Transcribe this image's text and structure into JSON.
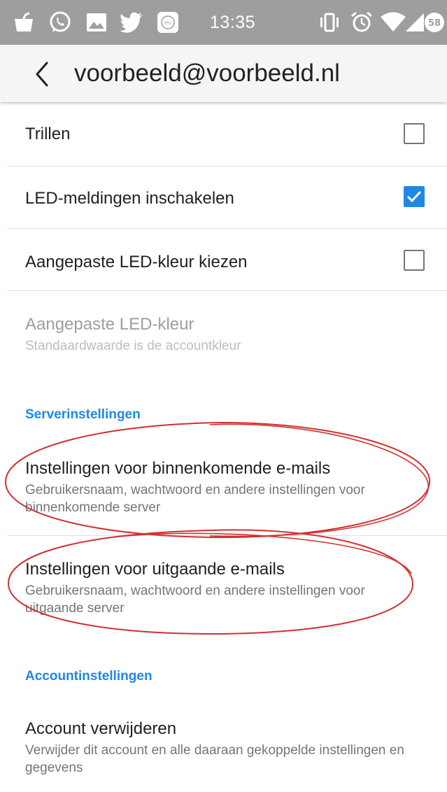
{
  "status_bar": {
    "time": "13:35",
    "battery_level": "58",
    "notification_icons": [
      "app-icon",
      "whatsapp-icon",
      "gallery-icon",
      "twitter-icon",
      "mi-icon"
    ],
    "system_icons": [
      "vibrate-icon",
      "alarm-icon",
      "wifi-icon",
      "signal-icon",
      "battery-icon"
    ]
  },
  "app_bar": {
    "title": "voorbeeld@voorbeeld.nl"
  },
  "settings": {
    "vibrate": {
      "label": "Trillen",
      "checked": false
    },
    "led_enable": {
      "label": "LED-meldingen inschakelen",
      "checked": true
    },
    "custom_led_choose": {
      "label": "Aangepaste LED-kleur kiezen",
      "checked": false
    },
    "custom_led_color": {
      "label": "Aangepaste LED-kleur",
      "summary": "Standaardwaarde is de accountkleur",
      "enabled": false
    }
  },
  "server_section": {
    "header": "Serverinstellingen",
    "incoming": {
      "label": "Instellingen voor binnenkomende e-mails",
      "summary": "Gebruikersnaam, wachtwoord en andere instellingen voor binnenkomende server"
    },
    "outgoing": {
      "label": "Instellingen voor uitgaande e-mails",
      "summary": "Gebruikersnaam, wachtwoord en andere instellingen voor uitgaande server"
    }
  },
  "account_section": {
    "header": "Accountinstellingen",
    "delete": {
      "label": "Account verwijderen",
      "summary": "Verwijder dit account en alle daaraan gekoppelde instellingen en gegevens"
    }
  },
  "colors": {
    "accent": "#1e88e5",
    "annotation": "#d32f2f",
    "status_bar": "#9e9e9e"
  }
}
